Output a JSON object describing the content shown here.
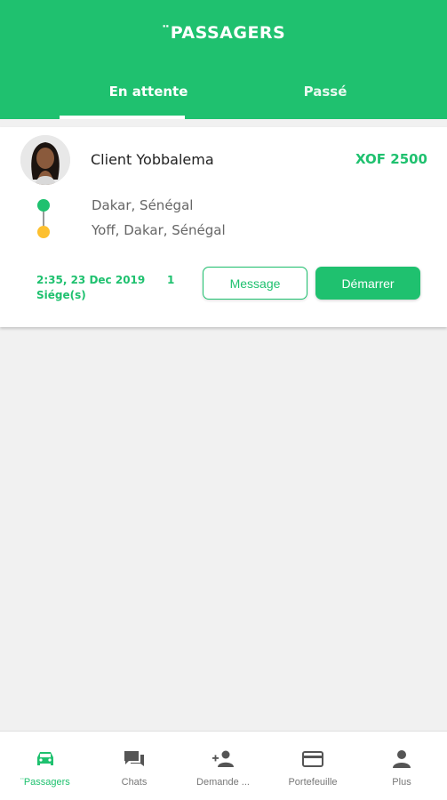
{
  "header": {
    "title": "¨PASSAGERS",
    "tabs": [
      {
        "label": "En attente",
        "active": true
      },
      {
        "label": "Passé",
        "active": false
      }
    ]
  },
  "ride": {
    "client_name": "Client Yobbalema",
    "price": "XOF 2500",
    "from": "Dakar, Sénégal",
    "to": "Yoff, Dakar, Sénégal",
    "datetime": "2:35, 23 Dec 2019",
    "seat_count": "1",
    "seat_label": "Siége(s)",
    "message_button": "Message",
    "start_button": "Démarrer"
  },
  "bottom_nav": [
    {
      "label": "¨Passagers",
      "icon": "car-icon",
      "active": true
    },
    {
      "label": "Chats",
      "icon": "chat-icon",
      "active": false
    },
    {
      "label": "Demande ...",
      "icon": "add-person-icon",
      "active": false
    },
    {
      "label": "Portefeuille",
      "icon": "card-icon",
      "active": false
    },
    {
      "label": "Plus",
      "icon": "person-icon",
      "active": false
    }
  ],
  "colors": {
    "primary": "#1fc16f",
    "pickup_dot": "#1fc16f",
    "dropoff_dot": "#fdc02f",
    "background": "#f1f1f1"
  }
}
